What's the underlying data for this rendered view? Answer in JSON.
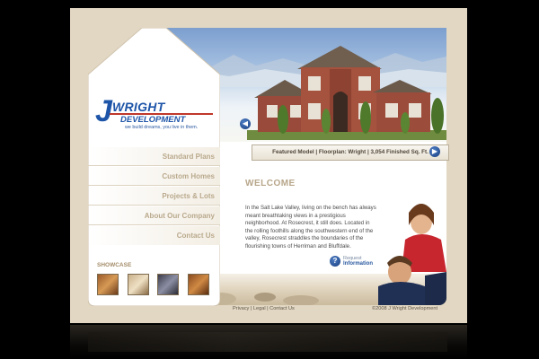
{
  "brand": {
    "logo_j": "J",
    "logo_line1": "WRIGHT",
    "logo_line2": "DEVELOPMENT",
    "tagline": "we build dreams, you live in them."
  },
  "nav": {
    "items": [
      {
        "label": "Standard Plans"
      },
      {
        "label": "Custom Homes"
      },
      {
        "label": "Projects & Lots"
      },
      {
        "label": "About Our Company"
      },
      {
        "label": "Contact Us"
      }
    ]
  },
  "showcase": {
    "title": "SHOWCASE",
    "thumbnails": [
      "kitchen-photo",
      "fireplace-photo",
      "living-room-photo",
      "dining-room-photo"
    ]
  },
  "featured": {
    "caption": "Featured Model  |  Floorplan: Wright  |  3,054 Finished Sq. Ft.",
    "prev_icon": "left-arrow-icon",
    "next_icon": "right-arrow-icon"
  },
  "main": {
    "heading": "WELCOME",
    "paragraph": "In the Salt Lake Valley, living on the bench has always meant breathtaking views in a prestigious neighborhood. At Rosecrest, it still does. Located in the rolling foothills along the southwestern end of the valley, Rosecrest straddles the boundaries of the flourishing towns of Herriman and Bluffdale."
  },
  "request": {
    "icon": "question-icon",
    "line1": "Request",
    "line2": "Information"
  },
  "footer": {
    "links": [
      "Privacy",
      "Legal",
      "Contact Us"
    ],
    "copyright": "©2008 J Wright Development"
  },
  "colors": {
    "accent_blue": "#1e55a8",
    "logo_red": "#c0392b",
    "nav_tan": "#b9a98c",
    "frame": "#e2d7c2"
  }
}
